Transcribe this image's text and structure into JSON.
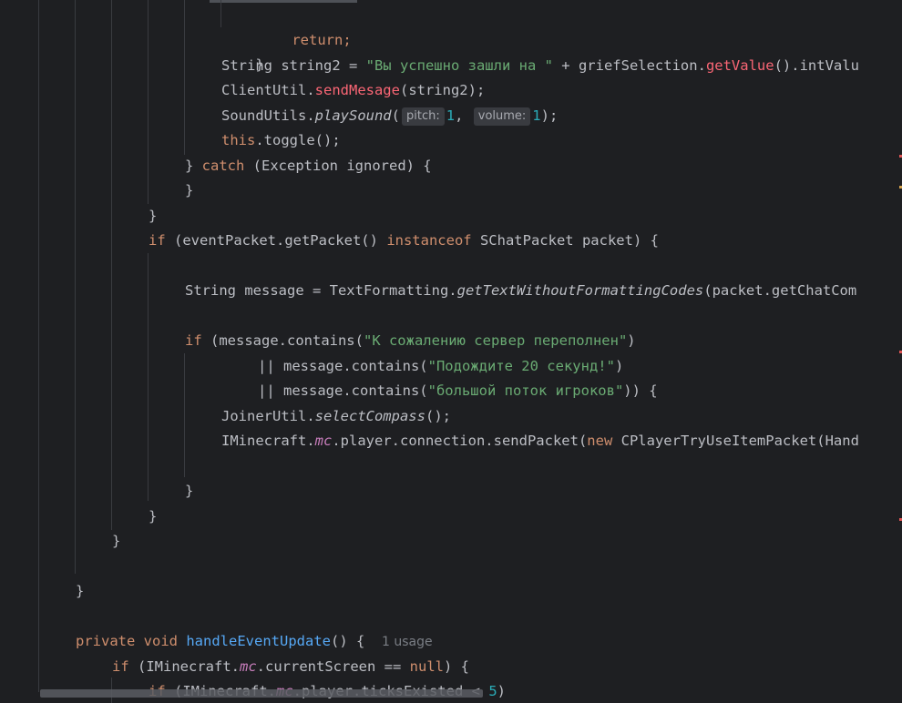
{
  "code": {
    "l1": "return;",
    "l2": "}",
    "l3_a": "String string2 = ",
    "l3_str": "\"Вы успешно зашли на \"",
    "l3_b": " + griefSelection.",
    "l3_fn": "getValue",
    "l3_c": "().intValu",
    "l4_a": "ClientUtil.",
    "l4_fn": "sendMesage",
    "l4_b": "(string2);",
    "l5_a": "SoundUtils.",
    "l5_fn": "playSound",
    "l5_b": "(",
    "l5_hint1": "pitch:",
    "l5_num1": "1",
    "l5_c": ", ",
    "l5_hint2": "volume:",
    "l5_num2": "1",
    "l5_d": ");",
    "l6_kw": "this",
    "l6_b": ".toggle();",
    "l7_a": "} ",
    "l7_kw": "catch",
    "l7_b": " (Exception ignored) {",
    "l8": "}",
    "l9": "}",
    "l10_kw": "if",
    "l10_a": " (eventPacket.getPacket() ",
    "l10_kw2": "instanceof",
    "l10_b": " SChatPacket packet) {",
    "l12_a": "String message = TextFormatting.",
    "l12_fn": "getTextWithoutFormattingCodes",
    "l12_b": "(packet.getChatCom",
    "l14_kw": "if",
    "l14_a": " (message.contains(",
    "l14_str": "\"К сожалению сервер переполнен\"",
    "l14_b": ")",
    "l15_a": "|| message.contains(",
    "l15_str": "\"Подождите 20 секунд!\"",
    "l15_b": ")",
    "l16_a": "|| message.contains(",
    "l16_str": "\"большой поток игроков\"",
    "l16_b": ")) {",
    "l17_a": "JoinerUtil.",
    "l17_fn": "selectCompass",
    "l17_b": "();",
    "l18_a": "IMinecraft.",
    "l18_st": "mc",
    "l18_b": ".player.connection.sendPacket(",
    "l18_kw": "new",
    "l18_c": " CPlayerTryUseItemPacket(Hand",
    "l20": "}",
    "l21": "}",
    "l22": "}",
    "l24": "}",
    "l26_kw1": "private",
    "l26_kw2": "void",
    "l26_fn": "handleEventUpdate",
    "l26_b": "() {",
    "l26_usage": "1 usage",
    "l27_kw": "if",
    "l27_a": " (IMinecraft.",
    "l27_st": "mc",
    "l27_b": ".currentScreen == ",
    "l27_kw2": "null",
    "l27_c": ") {",
    "l28_kw": "if",
    "l28_a": " (IMinecraft.",
    "l28_st": "mc",
    "l28_b": ".player.ticksExisted < ",
    "l28_num": "5",
    "l28_c": ")"
  },
  "colors": {
    "background": "#1e1f22",
    "text": "#bcbec4",
    "keyword": "#cf8e6d",
    "string": "#6aab73",
    "number": "#2aacb8",
    "function_decl": "#56a8f5",
    "unresolved": "#fa6675",
    "static_field": "#c77dbb"
  }
}
